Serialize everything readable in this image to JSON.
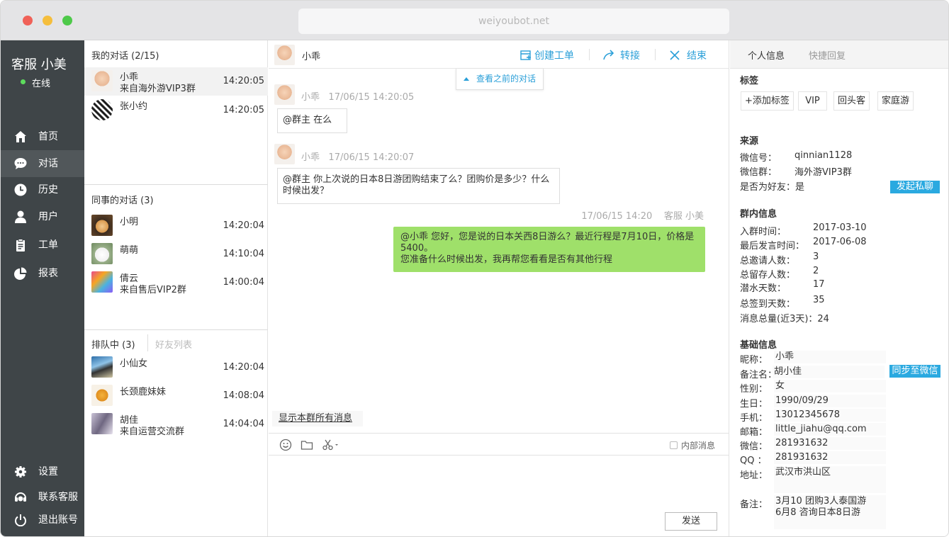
{
  "browser": {
    "url": "weiyoubot.net",
    "colors": {
      "close": "#f06158",
      "min": "#f5be3d",
      "max": "#4ec94a"
    }
  },
  "sidebar": {
    "agent_name": "客服 小美",
    "status": "在线",
    "nav": [
      {
        "label": "首页",
        "icon": "home-icon"
      },
      {
        "label": "对话",
        "icon": "chat-bubble-icon"
      },
      {
        "label": "历史",
        "icon": "clock-icon"
      },
      {
        "label": "用户",
        "icon": "user-icon"
      },
      {
        "label": "工单",
        "icon": "clipboard-icon"
      },
      {
        "label": "报表",
        "icon": "pie-chart-icon"
      }
    ],
    "bottom": [
      {
        "label": "设置",
        "icon": "gear-icon"
      },
      {
        "label": "联系客服",
        "icon": "headset-icon"
      },
      {
        "label": "退出账号",
        "icon": "power-icon"
      }
    ]
  },
  "convlist": {
    "mine_title": "我的对话 (2/15)",
    "mine": [
      {
        "name": "小乖",
        "sub": "来自海外游VIP3群",
        "time": "14:20:05"
      },
      {
        "name": "张小约",
        "sub": "",
        "time": "14:20:05"
      }
    ],
    "colleague_title": "同事的对话 (3)",
    "colleague": [
      {
        "name": "小明",
        "sub": "",
        "time": "14:20:04"
      },
      {
        "name": "萌萌",
        "sub": "",
        "time": "14:10:04"
      },
      {
        "name": "倩云",
        "sub": "来自售后VIP2群",
        "time": "14:00:04"
      }
    ],
    "queue_title": "排队中 (3)",
    "friends_tab": "好友列表",
    "queue": [
      {
        "name": "小仙女",
        "sub": "",
        "time": "14:20:04"
      },
      {
        "name": "长颈鹿妹妹",
        "sub": "",
        "time": "14:08:04"
      },
      {
        "name": "胡佳",
        "sub": "来自运营交流群",
        "time": "14:04:04"
      }
    ]
  },
  "chat": {
    "contact": "小乖",
    "actions": {
      "create_ticket": "创建工单",
      "transfer": "转接",
      "end": "结束"
    },
    "history_tip": "查看之前的对话",
    "messages": [
      {
        "sender": "小乖",
        "time": "17/06/15 14:20:05",
        "text": "@群主 在么"
      },
      {
        "sender": "小乖",
        "time": "17/06/15 14:20:07",
        "line1": "@群主  你上次说的日本8日游团购结束了么？团购价是多少？什么",
        "line2": "时候出发？"
      }
    ],
    "reply": {
      "time": "17/06/15 14:20",
      "sender": "客服 小美",
      "line1": "@小乖 您好，您是说的日本关西8日游么？最近行程是7月10日，价格是",
      "line2": "5400。",
      "line3": "您准备什么时候出发，我再帮您看看是否有其他行程"
    },
    "show_all": "显示本群所有消息",
    "internal_label": "内部消息",
    "send_label": "发送"
  },
  "panel": {
    "tabs": {
      "profile": "个人信息",
      "quick_reply": "快捷回复"
    },
    "tags_title": "标签",
    "tags": [
      "+添加标签",
      "VIP",
      "回头客",
      "家庭游"
    ],
    "source_title": "来源",
    "source": {
      "wechat_id_label": "微信号：",
      "wechat_id": "qinnian1128",
      "group_label": "微信群：",
      "group": "海外游VIP3群",
      "friend_label": "是否为好友：是",
      "private_chat_btn": "发起私聊"
    },
    "group_info_title": "群内信息",
    "group_info": [
      {
        "k": "入群时间：",
        "v": "2017-03-10"
      },
      {
        "k": "最后发言时间：",
        "v": "2017-06-08"
      },
      {
        "k": "总邀请人数：",
        "v": "3"
      },
      {
        "k": "总留存人数：",
        "v": "2"
      },
      {
        "k": "潜水天数：",
        "v": "17"
      },
      {
        "k": "总签到天数：",
        "v": "35"
      },
      {
        "k": "消息总量(近3天)：24",
        "v": ""
      }
    ],
    "basic_title": "基础信息",
    "sync_btn": "同步至微信",
    "basic": [
      {
        "k": "昵称：",
        "v": "小乖"
      },
      {
        "k": "备注名：",
        "v": "胡小佳"
      },
      {
        "k": "性别：",
        "v": "女"
      },
      {
        "k": "生日：",
        "v": "1990/09/29"
      },
      {
        "k": "手机：",
        "v": "13012345678"
      },
      {
        "k": "邮箱：",
        "v": "little_jiahu@qq.com"
      },
      {
        "k": "微信：",
        "v": "281931632"
      },
      {
        "k": "QQ ：",
        "v": "281931632"
      },
      {
        "k": "地址：",
        "v": "武汉市洪山区"
      }
    ],
    "note_label": "备注：",
    "note_line1": "3月10 团购3人泰国游",
    "note_line2": "6月8  咨询日本8日游"
  }
}
